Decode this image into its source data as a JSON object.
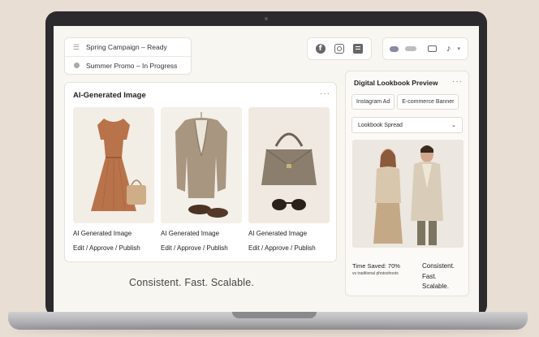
{
  "status_list": [
    {
      "icon": "menu-lines-icon",
      "label": "Spring Campaign – Ready"
    },
    {
      "icon": "status-dot-icon",
      "label": "Summer Promo – In Progress"
    }
  ],
  "social_buttons": [
    "facebook-icon",
    "instagram-icon",
    "document-icon"
  ],
  "toggles": [
    "toggle-pill-icon",
    "slider-pill-icon",
    "display-icon",
    "tiktok-icon",
    "chevron-down-icon"
  ],
  "ai_panel": {
    "title": "AI-Generated Image",
    "more": "···",
    "products": [
      {
        "name": "dress-with-handbag",
        "label": "AI Generated Image",
        "actions": "Edit / Approve / Publish"
      },
      {
        "name": "blazer-with-shoes",
        "label": "AI Generated Image",
        "actions": "Edit / Approve / Publish"
      },
      {
        "name": "handbag-with-sunglasses",
        "label": "AI Generated Image",
        "actions": "Edit / Approve / Publish"
      }
    ]
  },
  "tagline": "Consistent. Fast. Scalable.",
  "lookbook": {
    "title": "Digital Lookbook Preview",
    "more": "···",
    "tabs": [
      "Instagram Ad",
      "E-commerce Banner"
    ],
    "select_value": "Lookbook Spread",
    "time_saved": "Time Saved: 70%",
    "time_saved_sub": "vs traditional photoshoots",
    "summary_lines": [
      "Consistent.",
      "Fast.",
      "Scalable."
    ]
  },
  "colors": {
    "background": "#e8ded3",
    "screen": "#f8f6f1",
    "dress": "#b8734a",
    "blazer": "#a89680",
    "bag": "#8c7e6c"
  }
}
